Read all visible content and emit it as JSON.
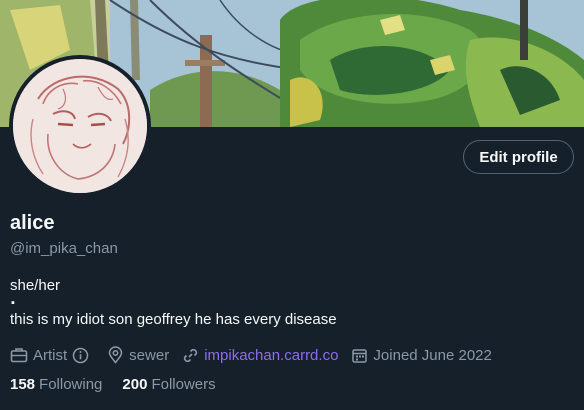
{
  "profile": {
    "name": "alice",
    "handle": "@im_pika_chan",
    "edit_label": "Edit profile",
    "bio_lines": [
      "she/her",
      "▪",
      "this is my idiot son geoffrey he has every disease"
    ]
  },
  "meta": {
    "category": "Artist",
    "location": "sewer",
    "link": "impikachan.carrd.co",
    "joined": "Joined June 2022"
  },
  "stats": {
    "following_count": "158",
    "following_label": "Following",
    "followers_count": "200",
    "followers_label": "Followers"
  },
  "icons": {
    "category": "briefcase-icon",
    "info": "info-circle-icon",
    "location": "location-pin-icon",
    "link": "link-icon",
    "joined": "calendar-icon"
  },
  "colors": {
    "background": "#15202b",
    "text": "#f7f9f9",
    "muted": "#8b98a5",
    "link": "#8e6cf0",
    "border": "#536471"
  }
}
